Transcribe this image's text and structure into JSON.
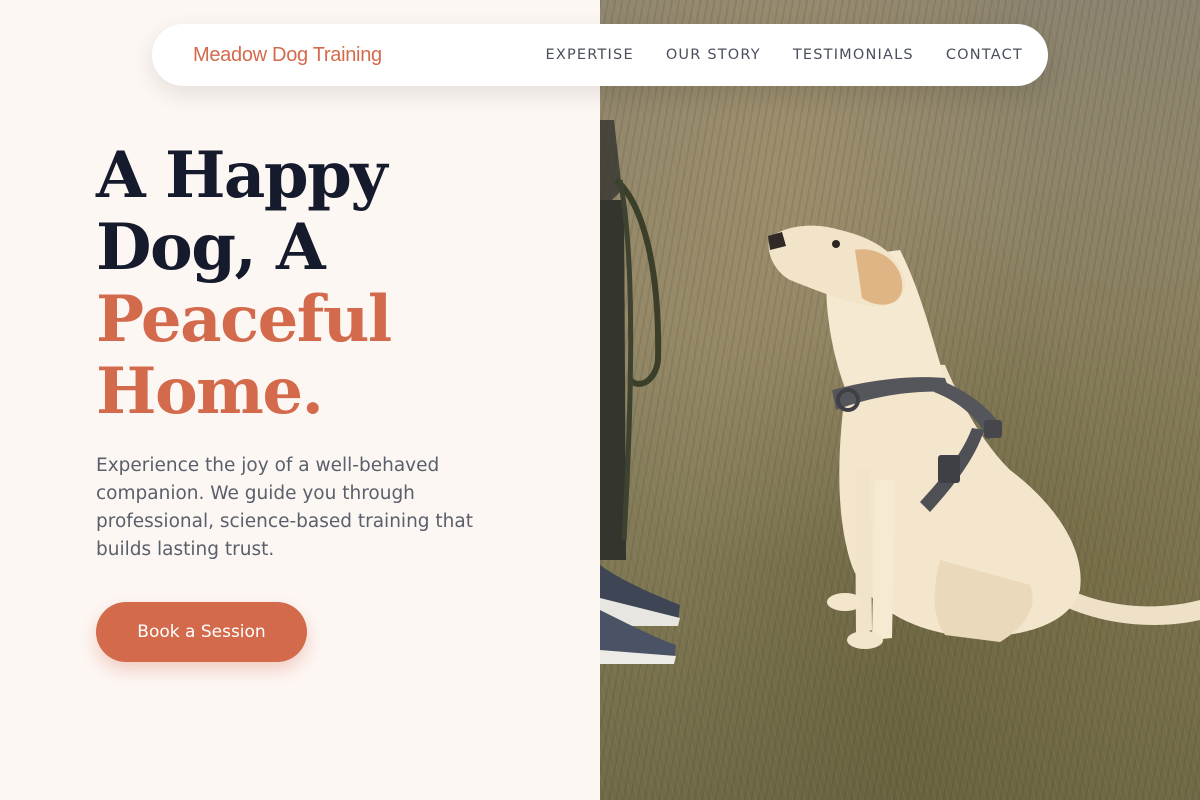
{
  "nav": {
    "brand": "Meadow Dog Training",
    "links": [
      "EXPERTISE",
      "OUR STORY",
      "TESTIMONIALS",
      "CONTACT"
    ]
  },
  "hero": {
    "title_line1": "A Happy",
    "title_line2": "Dog, A",
    "title_line3": "Peaceful",
    "title_line4": "Home.",
    "description": "Experience the joy of a well-behaved companion. We guide you through professional, science-based training that builds lasting trust.",
    "cta_label": "Book a Session"
  },
  "photo": {
    "subject": "labrador-sitting-with-trainer"
  },
  "colors": {
    "accent": "#d46a4c",
    "heading": "#151b2c",
    "body_text": "#5a5f6b",
    "background": "#fdf7f4"
  }
}
